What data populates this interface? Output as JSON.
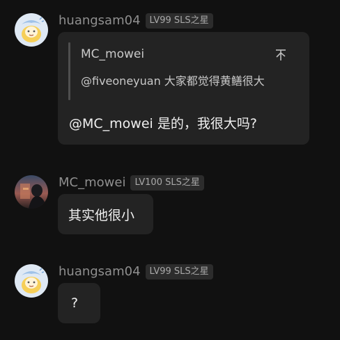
{
  "messages": [
    {
      "username": "huangsam04",
      "level": "LV99 SLS之星",
      "avatar_icon": "anime-avatar-icon",
      "quote": {
        "author": "MC_mowei",
        "text": "@fiveoneyuan 大家都觉得黄鳝很大",
        "action_icon": "collapse-icon"
      },
      "text": "@MC_mowei 是的，我很大吗?"
    },
    {
      "username": "MC_mowei",
      "level": "LV100 SLS之星",
      "avatar_icon": "photo-avatar-icon",
      "text": "其实他很小"
    },
    {
      "username": "huangsam04",
      "level": "LV99 SLS之星",
      "avatar_icon": "anime-avatar-icon",
      "text": "?"
    }
  ],
  "colors": {
    "background": "#111111",
    "bubble": "#232323",
    "badge": "#2c2c2c",
    "username": "#8f8f8f"
  }
}
